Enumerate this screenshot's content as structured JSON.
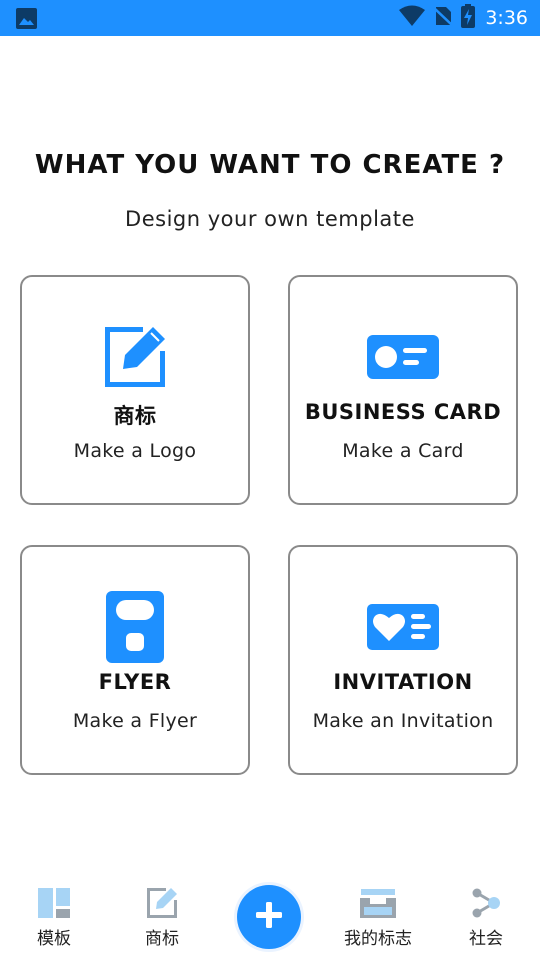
{
  "status_bar": {
    "time": "3:36",
    "icons": [
      "gallery-icon",
      "wifi-icon",
      "no-sim-icon",
      "battery-charging-icon"
    ]
  },
  "header": {
    "title": "WHAT YOU WANT TO CREATE ?",
    "subtitle": "Design your own template"
  },
  "cards": [
    {
      "icon": "edit-icon",
      "title": "商标",
      "description": "Make a Logo"
    },
    {
      "icon": "id-card-icon",
      "title": "BUSINESS CARD",
      "description": "Make a Card"
    },
    {
      "icon": "flyer-icon",
      "title": "FLYER",
      "description": "Make a Flyer"
    },
    {
      "icon": "heart-card-icon",
      "title": "INVITATION",
      "description": "Make an Invitation"
    }
  ],
  "bottom_nav": {
    "items": [
      {
        "icon": "template-icon",
        "label": "模板"
      },
      {
        "icon": "edit-icon",
        "label": "商标"
      },
      {
        "icon": "inbox-icon",
        "label": "我的标志"
      },
      {
        "icon": "share-icon",
        "label": "社会"
      }
    ],
    "fab_icon": "plus-icon"
  },
  "colors": {
    "accent": "#1e90ff",
    "nav_icon": "#a7d4f5",
    "nav_icon_gray": "#9aa4ad",
    "card_border": "#8a8a8a"
  }
}
